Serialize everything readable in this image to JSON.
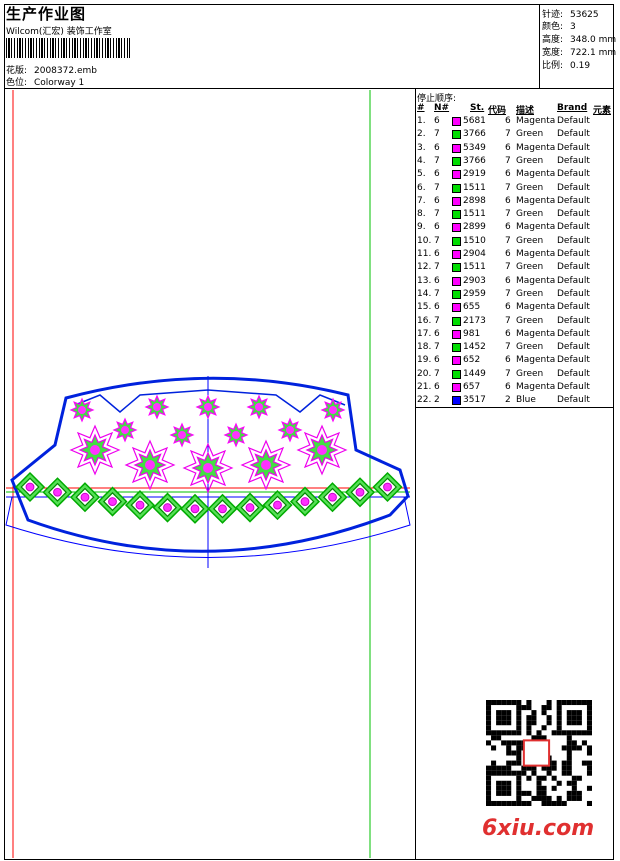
{
  "header": {
    "title": "生产作业图",
    "studio": "Wilcom(汇宏) 装饰工作室",
    "design_label": "花版:",
    "design_value": "2008372.emb",
    "colorway_label": "色位:",
    "colorway_value": "Colorway 1"
  },
  "stats": [
    {
      "label": "针迹:",
      "value": "53625"
    },
    {
      "label": "颜色:",
      "value": "3"
    },
    {
      "label": "高度:",
      "value": "348.0 mm"
    },
    {
      "label": "宽度:",
      "value": "722.1 mm"
    },
    {
      "label": "比例:",
      "value": "0.19"
    }
  ],
  "stop_sequence": {
    "title": "停止顺序:",
    "columns": [
      "#",
      "N#",
      "St.",
      "代码",
      "描述",
      "Brand",
      "元素"
    ],
    "rows": [
      {
        "idx": "1.",
        "n": "6",
        "color": "#ff00ff",
        "st": "5681",
        "code": "6",
        "desc": "Magenta",
        "brand": "Default"
      },
      {
        "idx": "2.",
        "n": "7",
        "color": "#00dd00",
        "st": "3766",
        "code": "7",
        "desc": "Green",
        "brand": "Default"
      },
      {
        "idx": "3.",
        "n": "6",
        "color": "#ff00ff",
        "st": "5349",
        "code": "6",
        "desc": "Magenta",
        "brand": "Default"
      },
      {
        "idx": "4.",
        "n": "7",
        "color": "#00dd00",
        "st": "3766",
        "code": "7",
        "desc": "Green",
        "brand": "Default"
      },
      {
        "idx": "5.",
        "n": "6",
        "color": "#ff00ff",
        "st": "2919",
        "code": "6",
        "desc": "Magenta",
        "brand": "Default"
      },
      {
        "idx": "6.",
        "n": "7",
        "color": "#00dd00",
        "st": "1511",
        "code": "7",
        "desc": "Green",
        "brand": "Default"
      },
      {
        "idx": "7.",
        "n": "6",
        "color": "#ff00ff",
        "st": "2898",
        "code": "6",
        "desc": "Magenta",
        "brand": "Default"
      },
      {
        "idx": "8.",
        "n": "7",
        "color": "#00dd00",
        "st": "1511",
        "code": "7",
        "desc": "Green",
        "brand": "Default"
      },
      {
        "idx": "9.",
        "n": "6",
        "color": "#ff00ff",
        "st": "2899",
        "code": "6",
        "desc": "Magenta",
        "brand": "Default"
      },
      {
        "idx": "10.",
        "n": "7",
        "color": "#00dd00",
        "st": "1510",
        "code": "7",
        "desc": "Green",
        "brand": "Default"
      },
      {
        "idx": "11.",
        "n": "6",
        "color": "#ff00ff",
        "st": "2904",
        "code": "6",
        "desc": "Magenta",
        "brand": "Default"
      },
      {
        "idx": "12.",
        "n": "7",
        "color": "#00dd00",
        "st": "1511",
        "code": "7",
        "desc": "Green",
        "brand": "Default"
      },
      {
        "idx": "13.",
        "n": "6",
        "color": "#ff00ff",
        "st": "2903",
        "code": "6",
        "desc": "Magenta",
        "brand": "Default"
      },
      {
        "idx": "14.",
        "n": "7",
        "color": "#00dd00",
        "st": "2959",
        "code": "7",
        "desc": "Green",
        "brand": "Default"
      },
      {
        "idx": "15.",
        "n": "6",
        "color": "#ff00ff",
        "st": "655",
        "code": "6",
        "desc": "Magenta",
        "brand": "Default"
      },
      {
        "idx": "16.",
        "n": "7",
        "color": "#00dd00",
        "st": "2173",
        "code": "7",
        "desc": "Green",
        "brand": "Default"
      },
      {
        "idx": "17.",
        "n": "6",
        "color": "#ff00ff",
        "st": "981",
        "code": "6",
        "desc": "Magenta",
        "brand": "Default"
      },
      {
        "idx": "18.",
        "n": "7",
        "color": "#00dd00",
        "st": "1452",
        "code": "7",
        "desc": "Green",
        "brand": "Default"
      },
      {
        "idx": "19.",
        "n": "6",
        "color": "#ff00ff",
        "st": "652",
        "code": "6",
        "desc": "Magenta",
        "brand": "Default"
      },
      {
        "idx": "20.",
        "n": "7",
        "color": "#00dd00",
        "st": "1449",
        "code": "7",
        "desc": "Green",
        "brand": "Default"
      },
      {
        "idx": "21.",
        "n": "6",
        "color": "#ff00ff",
        "st": "657",
        "code": "6",
        "desc": "Magenta",
        "brand": "Default"
      },
      {
        "idx": "22.",
        "n": "2",
        "color": "#0000ff",
        "st": "3517",
        "code": "2",
        "desc": "Blue",
        "brand": "Default"
      }
    ]
  },
  "watermark": {
    "text": "6xiu.com"
  }
}
